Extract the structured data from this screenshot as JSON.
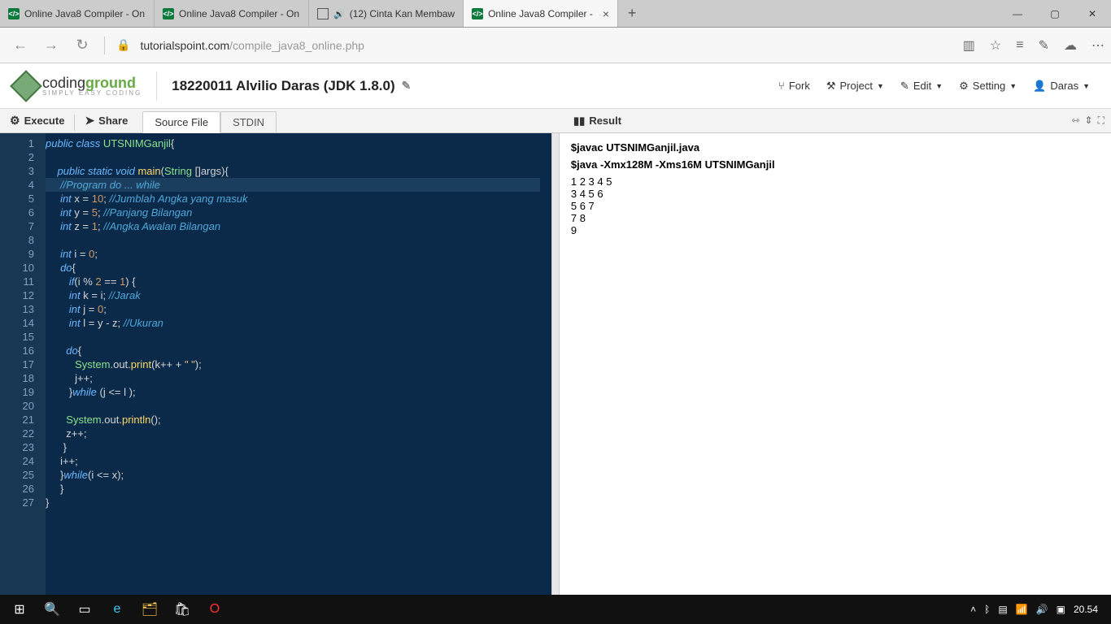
{
  "browser": {
    "tabs": [
      {
        "label": "Online Java8 Compiler - On",
        "active": false,
        "icon": "code"
      },
      {
        "label": "Online Java8 Compiler - On",
        "active": false,
        "icon": "code"
      },
      {
        "label": "(12) Cinta Kan Membaw",
        "active": false,
        "icon": "sound"
      },
      {
        "label": "Online Java8 Compiler - ",
        "active": true,
        "icon": "code"
      }
    ],
    "url_host": "tutorialspoint.com",
    "url_path": "/compile_java8_online.php"
  },
  "site": {
    "logo_main": "coding",
    "logo_bold": "ground",
    "logo_sub": "SIMPLY EASY CODING",
    "project_title": "18220011 Alvilio Daras (JDK 1.8.0)",
    "menu": {
      "fork": "Fork",
      "project": "Project",
      "edit": "Edit",
      "setting": "Setting",
      "user": "Daras"
    }
  },
  "toolbar": {
    "execute": "Execute",
    "share": "Share",
    "tab_source": "Source File",
    "tab_stdin": "STDIN"
  },
  "editor": {
    "highlighted_line": 4,
    "lines": [
      [
        {
          "t": "public ",
          "c": "kw"
        },
        {
          "t": "class ",
          "c": "kw"
        },
        {
          "t": "UTSNIMGanjil",
          "c": "cl"
        },
        {
          "t": "{",
          "c": "pn"
        }
      ],
      [],
      [
        {
          "t": "    ",
          "c": "op"
        },
        {
          "t": "public ",
          "c": "kw"
        },
        {
          "t": "static ",
          "c": "kw"
        },
        {
          "t": "void ",
          "c": "tp"
        },
        {
          "t": "main",
          "c": "fn"
        },
        {
          "t": "(",
          "c": "pn"
        },
        {
          "t": "String ",
          "c": "cl"
        },
        {
          "t": "[]",
          "c": "pn"
        },
        {
          "t": "args",
          "c": "op"
        },
        {
          "t": "){",
          "c": "pn"
        }
      ],
      [
        {
          "t": "     ",
          "c": "op"
        },
        {
          "t": "//Program do ... while",
          "c": "cm"
        }
      ],
      [
        {
          "t": "     ",
          "c": "op"
        },
        {
          "t": "int ",
          "c": "tp"
        },
        {
          "t": "x ",
          "c": "op"
        },
        {
          "t": "= ",
          "c": "op"
        },
        {
          "t": "10",
          "c": "num"
        },
        {
          "t": "; ",
          "c": "pn"
        },
        {
          "t": "//Jumblah Angka yang masuk",
          "c": "cm"
        }
      ],
      [
        {
          "t": "     ",
          "c": "op"
        },
        {
          "t": "int ",
          "c": "tp"
        },
        {
          "t": "y ",
          "c": "op"
        },
        {
          "t": "= ",
          "c": "op"
        },
        {
          "t": "5",
          "c": "num"
        },
        {
          "t": "; ",
          "c": "pn"
        },
        {
          "t": "//Panjang Bilangan",
          "c": "cm"
        }
      ],
      [
        {
          "t": "     ",
          "c": "op"
        },
        {
          "t": "int ",
          "c": "tp"
        },
        {
          "t": "z ",
          "c": "op"
        },
        {
          "t": "= ",
          "c": "op"
        },
        {
          "t": "1",
          "c": "num"
        },
        {
          "t": "; ",
          "c": "pn"
        },
        {
          "t": "//Angka Awalan Bilangan",
          "c": "cm"
        }
      ],
      [],
      [
        {
          "t": "     ",
          "c": "op"
        },
        {
          "t": "int ",
          "c": "tp"
        },
        {
          "t": "i ",
          "c": "op"
        },
        {
          "t": "= ",
          "c": "op"
        },
        {
          "t": "0",
          "c": "num"
        },
        {
          "t": ";",
          "c": "pn"
        }
      ],
      [
        {
          "t": "     ",
          "c": "op"
        },
        {
          "t": "do",
          "c": "kw"
        },
        {
          "t": "{",
          "c": "pn"
        }
      ],
      [
        {
          "t": "        ",
          "c": "op"
        },
        {
          "t": "if",
          "c": "kw"
        },
        {
          "t": "(",
          "c": "pn"
        },
        {
          "t": "i ",
          "c": "op"
        },
        {
          "t": "% ",
          "c": "op"
        },
        {
          "t": "2 ",
          "c": "num"
        },
        {
          "t": "== ",
          "c": "op"
        },
        {
          "t": "1",
          "c": "num"
        },
        {
          "t": ") {",
          "c": "pn"
        }
      ],
      [
        {
          "t": "        ",
          "c": "op"
        },
        {
          "t": "int ",
          "c": "tp"
        },
        {
          "t": "k ",
          "c": "op"
        },
        {
          "t": "= ",
          "c": "op"
        },
        {
          "t": "i",
          "c": "op"
        },
        {
          "t": "; ",
          "c": "pn"
        },
        {
          "t": "//Jarak",
          "c": "cm"
        }
      ],
      [
        {
          "t": "        ",
          "c": "op"
        },
        {
          "t": "int ",
          "c": "tp"
        },
        {
          "t": "j ",
          "c": "op"
        },
        {
          "t": "= ",
          "c": "op"
        },
        {
          "t": "0",
          "c": "num"
        },
        {
          "t": ";",
          "c": "pn"
        }
      ],
      [
        {
          "t": "        ",
          "c": "op"
        },
        {
          "t": "int ",
          "c": "tp"
        },
        {
          "t": "l ",
          "c": "op"
        },
        {
          "t": "= ",
          "c": "op"
        },
        {
          "t": "y ",
          "c": "op"
        },
        {
          "t": "- ",
          "c": "op"
        },
        {
          "t": "z",
          "c": "op"
        },
        {
          "t": "; ",
          "c": "pn"
        },
        {
          "t": "//Ukuran",
          "c": "cm"
        }
      ],
      [],
      [
        {
          "t": "       ",
          "c": "op"
        },
        {
          "t": "do",
          "c": "kw"
        },
        {
          "t": "{",
          "c": "pn"
        }
      ],
      [
        {
          "t": "          ",
          "c": "op"
        },
        {
          "t": "System",
          "c": "cl"
        },
        {
          "t": ".",
          "c": "pn"
        },
        {
          "t": "out",
          "c": "op"
        },
        {
          "t": ".",
          "c": "pn"
        },
        {
          "t": "print",
          "c": "fn"
        },
        {
          "t": "(",
          "c": "pn"
        },
        {
          "t": "k",
          "c": "op"
        },
        {
          "t": "++ + ",
          "c": "op"
        },
        {
          "t": "\" \"",
          "c": "str"
        },
        {
          "t": ");",
          "c": "pn"
        }
      ],
      [
        {
          "t": "          ",
          "c": "op"
        },
        {
          "t": "j",
          "c": "op"
        },
        {
          "t": "++;",
          "c": "pn"
        }
      ],
      [
        {
          "t": "        }",
          "c": "pn"
        },
        {
          "t": "while ",
          "c": "kw"
        },
        {
          "t": "(",
          "c": "pn"
        },
        {
          "t": "j ",
          "c": "op"
        },
        {
          "t": "<= ",
          "c": "op"
        },
        {
          "t": "l ",
          "c": "op"
        },
        {
          "t": ");",
          "c": "pn"
        }
      ],
      [],
      [
        {
          "t": "       ",
          "c": "op"
        },
        {
          "t": "System",
          "c": "cl"
        },
        {
          "t": ".",
          "c": "pn"
        },
        {
          "t": "out",
          "c": "op"
        },
        {
          "t": ".",
          "c": "pn"
        },
        {
          "t": "println",
          "c": "fn"
        },
        {
          "t": "();",
          "c": "pn"
        }
      ],
      [
        {
          "t": "       ",
          "c": "op"
        },
        {
          "t": "z",
          "c": "op"
        },
        {
          "t": "++;",
          "c": "pn"
        }
      ],
      [
        {
          "t": "      }",
          "c": "pn"
        }
      ],
      [
        {
          "t": "     ",
          "c": "op"
        },
        {
          "t": "i",
          "c": "op"
        },
        {
          "t": "++;",
          "c": "pn"
        }
      ],
      [
        {
          "t": "     }",
          "c": "pn"
        },
        {
          "t": "while",
          "c": "kw"
        },
        {
          "t": "(",
          "c": "pn"
        },
        {
          "t": "i ",
          "c": "op"
        },
        {
          "t": "<= ",
          "c": "op"
        },
        {
          "t": "x",
          "c": "op"
        },
        {
          "t": ");",
          "c": "pn"
        }
      ],
      [
        {
          "t": "     }",
          "c": "pn"
        }
      ],
      [
        {
          "t": "}",
          "c": "pn"
        }
      ]
    ]
  },
  "result": {
    "title": "Result",
    "cmd1": "$javac UTSNIMGanjil.java",
    "cmd2": "$java -Xmx128M -Xms16M UTSNIMGanjil",
    "output": "1 2 3 4 5 \n3 4 5 6 \n5 6 7 \n7 8 \n9 "
  },
  "taskbar": {
    "clock": "20.54"
  }
}
